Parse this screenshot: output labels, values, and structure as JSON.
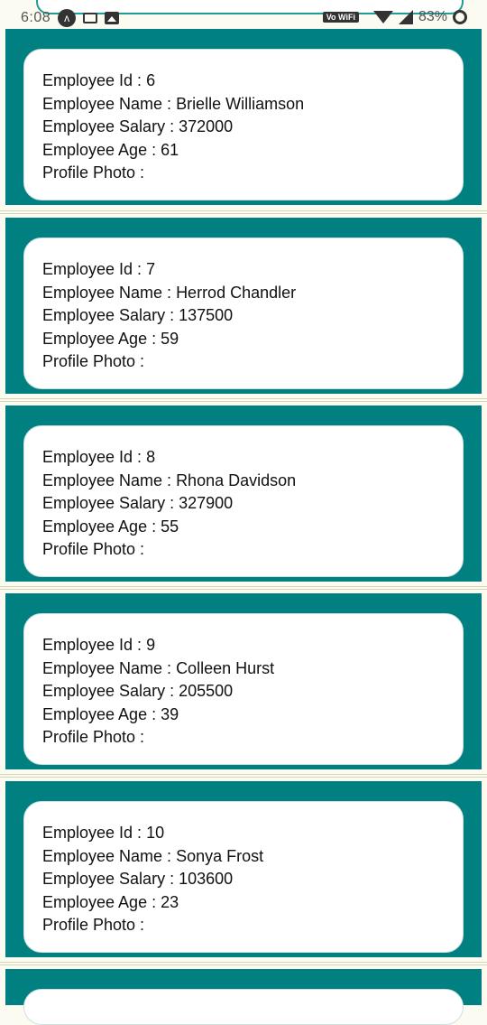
{
  "status_bar": {
    "time": "6:08",
    "nav_icon_glyph": "ʌ",
    "volte_badge": "Vo WiFi",
    "battery": "83%",
    "icons": [
      "navigation-icon",
      "cast-icon",
      "image-icon",
      "wifi-icon",
      "signal-icon",
      "battery-icon"
    ]
  },
  "labels": {
    "id": "Employee Id : ",
    "name": "Employee Name : ",
    "salary": "Employee Salary : ",
    "age": "Employee Age : ",
    "photo": "Profile Photo :"
  },
  "colors": {
    "panel": "#008080",
    "card": "#ffffff",
    "background": "#fbfbf1"
  },
  "employees": [
    {
      "id": "6",
      "name": "Brielle Williamson",
      "salary": "372000",
      "age": "61"
    },
    {
      "id": "7",
      "name": "Herrod Chandler",
      "salary": "137500",
      "age": "59"
    },
    {
      "id": "8",
      "name": "Rhona Davidson",
      "salary": "327900",
      "age": "55"
    },
    {
      "id": "9",
      "name": "Colleen Hurst",
      "salary": "205500",
      "age": "39"
    },
    {
      "id": "10",
      "name": "Sonya Frost",
      "salary": "103600",
      "age": "23"
    }
  ]
}
